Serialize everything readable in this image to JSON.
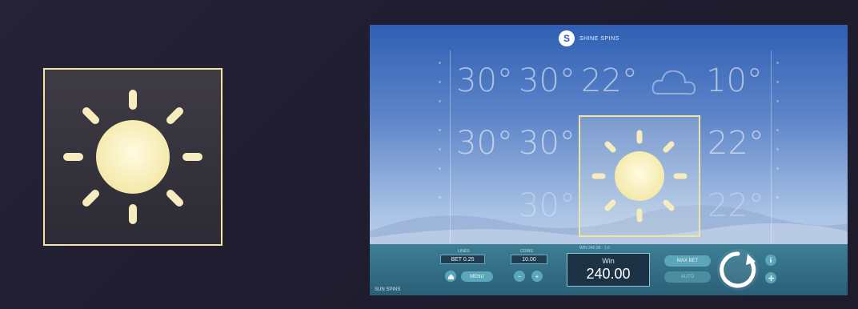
{
  "preview": {
    "icon": "sun-icon",
    "border_color": "#f1e6a3"
  },
  "game": {
    "logo_text": "S",
    "title": "SHINE SPINS",
    "reels": {
      "row1": [
        "30°",
        "30°",
        "22°",
        "10°"
      ],
      "row2": [
        "30°",
        "30°",
        "22°"
      ],
      "row3": [
        "30°",
        "22°"
      ]
    },
    "highlight_icon": "sun-icon",
    "controls": {
      "bet_caption": "LINES",
      "bet_value": "BET 0.25",
      "coin_caption": "COINS",
      "coin_value": "10.00",
      "win_caption": "WIN 240.00 · 1.0",
      "win_label": "Win",
      "win_value": "240.00",
      "max_bet_label": "MAX BET",
      "auto_label": "AUTO",
      "menu_label": "MENU",
      "footer": "SUN SPINS"
    },
    "accent_color": "#efe5a3"
  }
}
